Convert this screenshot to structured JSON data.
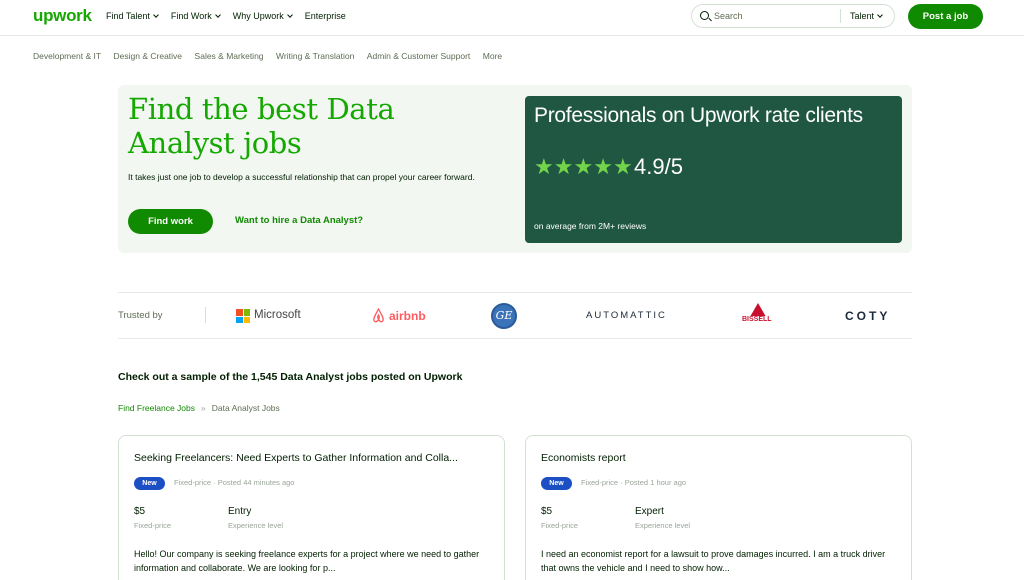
{
  "header": {
    "logo": "upwork",
    "nav": [
      "Find Talent",
      "Find Work",
      "Why Upwork",
      "Enterprise"
    ],
    "search_placeholder": "Search",
    "search_scope": "Talent",
    "post_job": "Post a job"
  },
  "categories": [
    "Development & IT",
    "Design & Creative",
    "Sales & Marketing",
    "Writing & Translation",
    "Admin & Customer Support",
    "More"
  ],
  "hero": {
    "title": "Find the best Data Analyst jobs",
    "subtitle": "It takes just one job to develop a successful relationship that can propel your career forward.",
    "find_work": "Find work",
    "hire_link": "Want to hire a Data Analyst?",
    "rating_card": {
      "title": "Professionals on Upwork rate clients",
      "stars": 5,
      "rating": "4.9/5",
      "note": "on average from 2M+ reviews",
      "star_color": "#73d44b"
    }
  },
  "trusted": {
    "label": "Trusted by",
    "logos": [
      "Microsoft",
      "airbnb",
      "GE",
      "AUTOMATTIC",
      "BISSELL",
      "COTY"
    ]
  },
  "sample": {
    "title": "Check out a sample of the 1,545 Data Analyst jobs posted on Upwork",
    "breadcrumb": [
      "Find Freelance Jobs",
      "Data Analyst Jobs"
    ]
  },
  "jobs": [
    {
      "title": "Seeking Freelancers: Need Experts to Gather Information and Colla...",
      "badge": "New",
      "meta": "Fixed-price · Posted 44 minutes ago",
      "price": "$5",
      "price_label": "Fixed-price",
      "level": "Entry",
      "level_label": "Experience level",
      "description": "Hello! Our company is seeking freelance experts for a project where we need to gather information and collaborate. We are looking for p..."
    },
    {
      "title": "Economists report",
      "badge": "New",
      "meta": "Fixed-price · Posted 1 hour ago",
      "price": "$5",
      "price_label": "Fixed-price",
      "level": "Expert",
      "level_label": "Experience level",
      "description": "I need an economist report for a lawsuit to prove damages incurred. I am a truck driver that owns the vehicle and I need to show how..."
    }
  ],
  "colors": {
    "brand_green": "#14a800",
    "button_green": "#108a00",
    "card_dark": "#1f5743",
    "badge_blue": "#1c4fc4"
  }
}
